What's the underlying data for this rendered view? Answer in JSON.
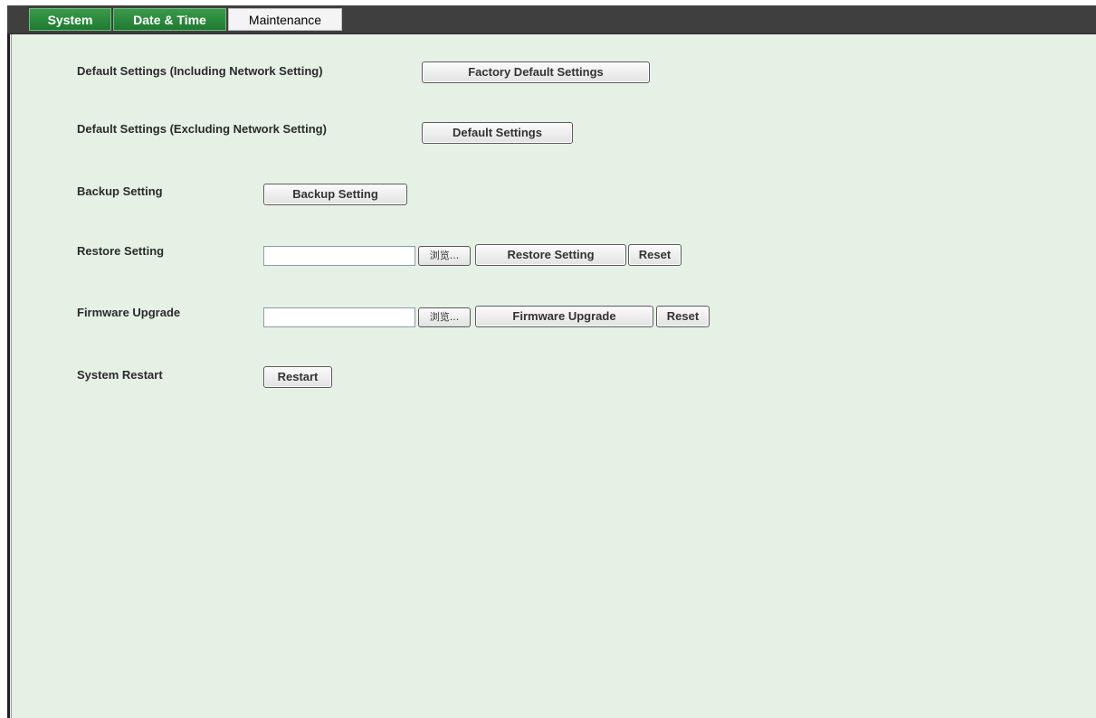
{
  "tabs": [
    {
      "label": "System",
      "active": false
    },
    {
      "label": "Date & Time",
      "active": false
    },
    {
      "label": "Maintenance",
      "active": true
    }
  ],
  "colors": {
    "tab_green": "#1f7a31",
    "tab_bar": "#3f3f3f",
    "content_bg": "#e6f1e6"
  },
  "rows": {
    "factory_default": {
      "label": "Default Settings (Including Network Setting)",
      "button": "Factory Default Settings"
    },
    "default": {
      "label": "Default Settings (Excluding Network Setting)",
      "button": "Default Settings"
    },
    "backup": {
      "label": "Backup Setting",
      "button": "Backup Setting"
    },
    "restore": {
      "label": "Restore Setting",
      "file_value": "",
      "browse": "浏览...",
      "button": "Restore Setting",
      "reset": "Reset"
    },
    "firmware": {
      "label": "Firmware Upgrade",
      "file_value": "",
      "browse": "浏览...",
      "button": "Firmware Upgrade",
      "reset": "Reset"
    },
    "restart": {
      "label": "System Restart",
      "button": "Restart"
    }
  }
}
